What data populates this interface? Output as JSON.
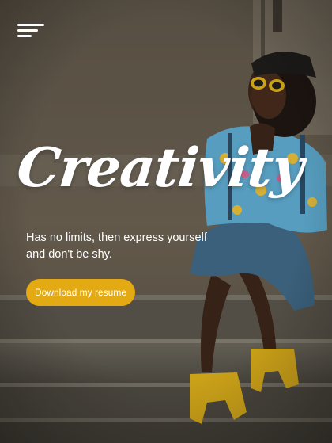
{
  "header": {
    "menu_icon": "hamburger-menu-icon"
  },
  "hero": {
    "headline": "Creativity",
    "tagline_line1": "Has no limits, then express yourself",
    "tagline_line2": "and don't be shy.",
    "cta_label": "Download my resume"
  },
  "colors": {
    "accent": "#e3aa14",
    "text": "#ffffff"
  }
}
